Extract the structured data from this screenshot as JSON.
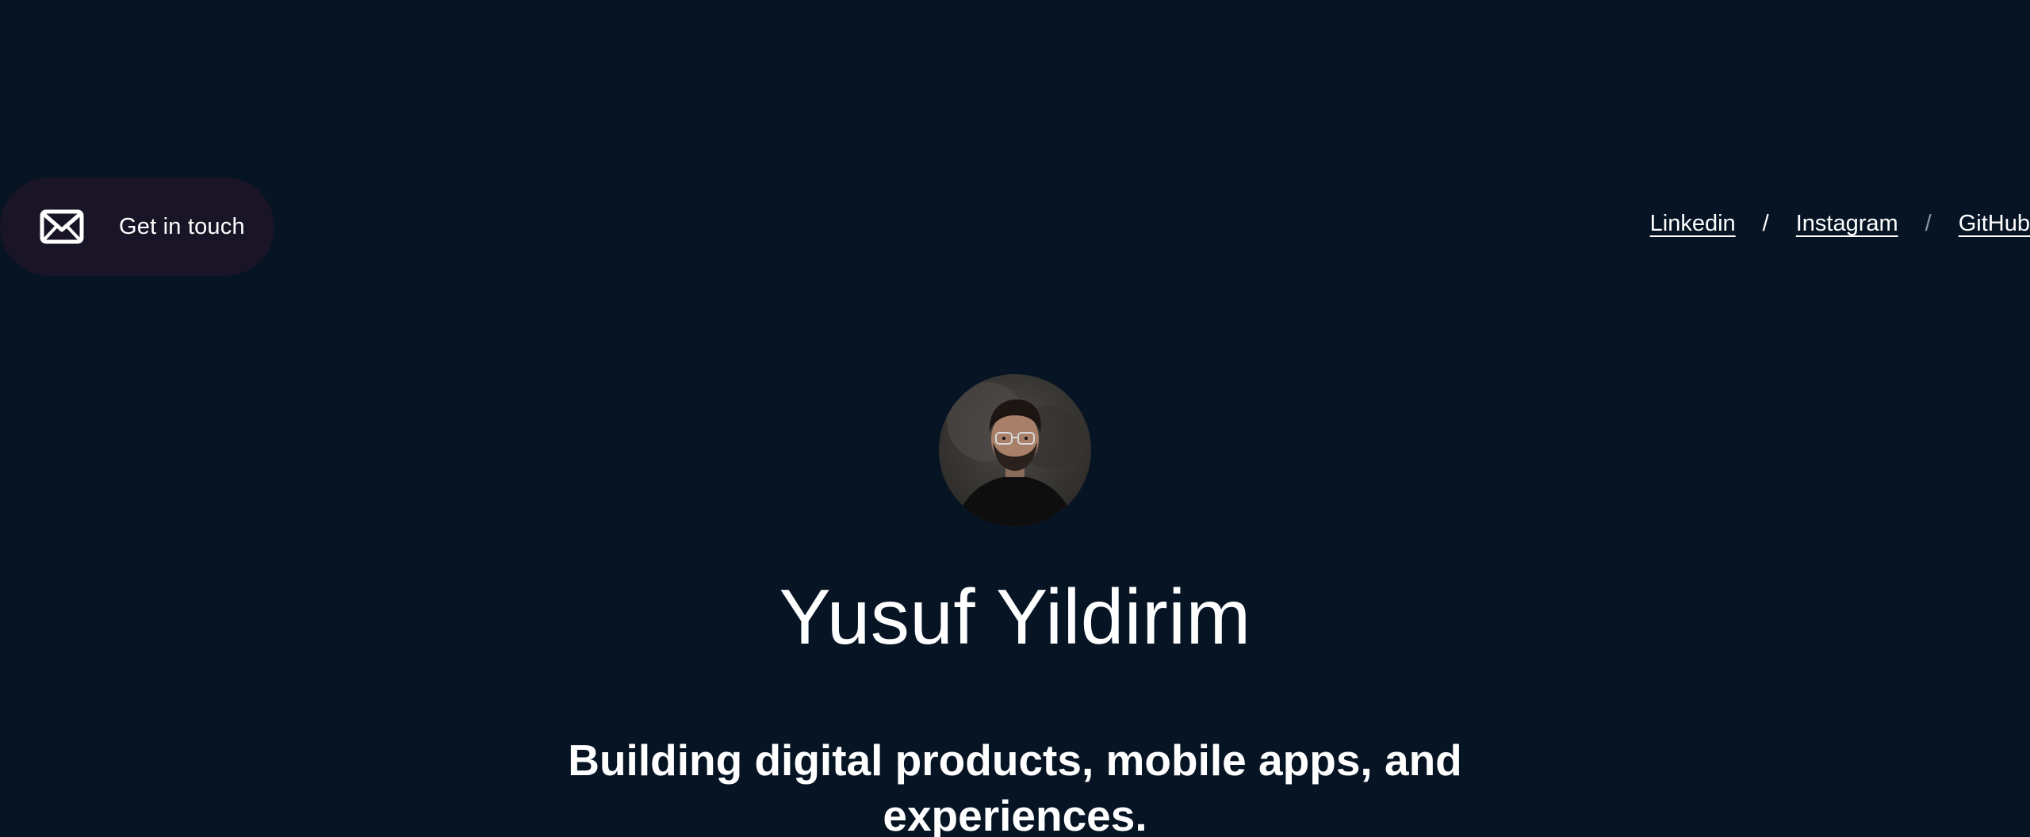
{
  "header": {
    "contact_button": {
      "label": "Get in touch",
      "icon": "mail-icon"
    },
    "social_links": [
      {
        "label": "Linkedin"
      },
      {
        "label": "Instagram"
      },
      {
        "label": "GitHub"
      }
    ],
    "separator": "/"
  },
  "hero": {
    "avatar_icon": "avatar-photo",
    "name": "Yusuf Yildirim",
    "tagline": "Building digital products, mobile apps, and experiences."
  },
  "colors": {
    "background": "#061424",
    "contact_button_bg": "#1a1526",
    "text": "#ffffff",
    "separator_dim": "#8a95a3"
  }
}
